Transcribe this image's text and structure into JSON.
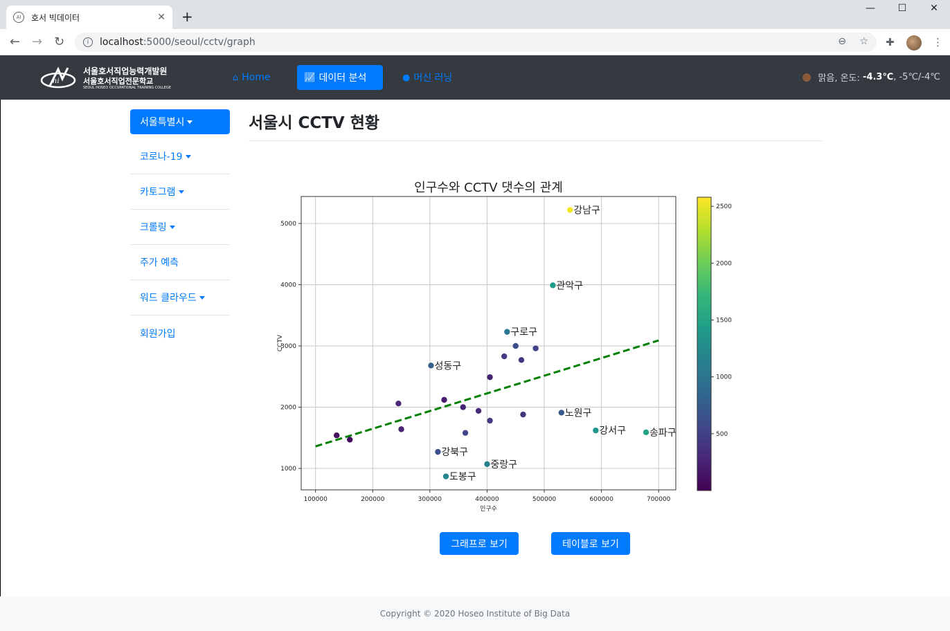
{
  "browser": {
    "tab_title": "호서 빅데이터",
    "tab_icon": "ai-favicon-icon",
    "url_host": "localhost",
    "url_path": ":5000/seoul/cctv/graph"
  },
  "navbar": {
    "logo_line1": "서울호서직업능력개발원",
    "logo_line2": "서울호서직업전문학교",
    "logo_line3": "SEOUL HOSEO OCCUPATIONAL TRAINING COLLEGE",
    "links": [
      {
        "label": "Home",
        "icon": "home-icon"
      },
      {
        "label": "데이터 분석",
        "icon": "chart-line-icon"
      },
      {
        "label": "머신 러닝",
        "icon": "brain-icon"
      }
    ],
    "weather_prefix": "맑음, 온도:",
    "weather_temp": "-4.3℃",
    "weather_range": ", -5℃/-4℃"
  },
  "sidebar": {
    "items": [
      {
        "label": "서울특별시",
        "dropdown": true
      },
      {
        "label": "코로나-19",
        "dropdown": true
      },
      {
        "label": "카토그램",
        "dropdown": true
      },
      {
        "label": "크롤링",
        "dropdown": true
      },
      {
        "label": "주가 예측",
        "dropdown": false
      },
      {
        "label": "워드 클라우드",
        "dropdown": true
      },
      {
        "label": "회원가입",
        "dropdown": false
      }
    ]
  },
  "main": {
    "title": "서울시 CCTV 현황",
    "graph_button": "그래프로 보기",
    "table_button": "테이블로 보기"
  },
  "footer": {
    "text": "Copyright © 2020 Hoseo Institute of Big Data"
  },
  "chart_data": {
    "type": "scatter",
    "title": "인구수와 CCTV 댓수의 관계",
    "xlabel": "인구수",
    "ylabel": "CCTV",
    "xlim": [
      75000,
      730000
    ],
    "ylim": [
      650000,
      5440
    ],
    "xticks": [
      100000,
      200000,
      300000,
      400000,
      500000,
      600000,
      700000
    ],
    "yticks": [
      1000,
      2000,
      3000,
      4000,
      5000
    ],
    "grid": true,
    "colormap": "viridis",
    "colorbar_ticks": [
      500,
      1000,
      1500,
      2000,
      2500
    ],
    "colorbar_range": [
      0,
      2580
    ],
    "trendline": {
      "x": [
        100000,
        700000
      ],
      "y": [
        1360,
        3090
      ],
      "color": "#008000",
      "style": "dashed"
    },
    "points": [
      {
        "x": 545000,
        "y": 5220,
        "c": 2550,
        "label": "강남구"
      },
      {
        "x": 515000,
        "y": 3990,
        "c": 1400,
        "label": "관악구"
      },
      {
        "x": 435000,
        "y": 3230,
        "c": 1050,
        "label": "구로구"
      },
      {
        "x": 302000,
        "y": 2680,
        "c": 800,
        "label": "성동구"
      },
      {
        "x": 530000,
        "y": 1910,
        "c": 700,
        "label": "노원구"
      },
      {
        "x": 590000,
        "y": 1620,
        "c": 1350,
        "label": "강서구"
      },
      {
        "x": 678000,
        "y": 1590,
        "c": 1500,
        "label": "송파구"
      },
      {
        "x": 314000,
        "y": 1270,
        "c": 650,
        "label": "강북구"
      },
      {
        "x": 400000,
        "y": 1070,
        "c": 1150,
        "label": "중랑구"
      },
      {
        "x": 328000,
        "y": 870,
        "c": 1200,
        "label": "도봉구"
      },
      {
        "x": 450000,
        "y": 3000,
        "c": 600,
        "label": ""
      },
      {
        "x": 485000,
        "y": 2960,
        "c": 500,
        "label": ""
      },
      {
        "x": 430000,
        "y": 2830,
        "c": 450,
        "label": ""
      },
      {
        "x": 460000,
        "y": 2770,
        "c": 400,
        "label": ""
      },
      {
        "x": 405000,
        "y": 2490,
        "c": 250,
        "label": ""
      },
      {
        "x": 245000,
        "y": 2060,
        "c": 300,
        "label": ""
      },
      {
        "x": 325000,
        "y": 2120,
        "c": 200,
        "label": ""
      },
      {
        "x": 358000,
        "y": 2000,
        "c": 250,
        "label": ""
      },
      {
        "x": 385000,
        "y": 1940,
        "c": 300,
        "label": ""
      },
      {
        "x": 463000,
        "y": 1880,
        "c": 400,
        "label": ""
      },
      {
        "x": 405000,
        "y": 1780,
        "c": 450,
        "label": ""
      },
      {
        "x": 250000,
        "y": 1640,
        "c": 250,
        "label": ""
      },
      {
        "x": 362000,
        "y": 1580,
        "c": 550,
        "label": ""
      },
      {
        "x": 137000,
        "y": 1540,
        "c": 100,
        "label": ""
      },
      {
        "x": 160000,
        "y": 1470,
        "c": 60,
        "label": ""
      }
    ]
  }
}
